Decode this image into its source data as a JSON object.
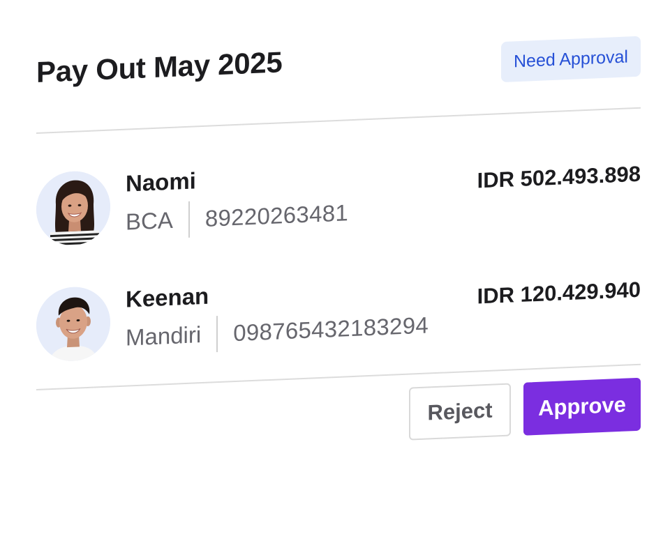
{
  "header": {
    "title": "Pay Out May 2025",
    "status_badge": "Need Approval"
  },
  "payees": [
    {
      "name": "Naomi",
      "bank": "BCA",
      "account_number": "89220263481",
      "amount": "IDR 502.493.898"
    },
    {
      "name": "Keenan",
      "bank": "Mandiri",
      "account_number": "098765432183294",
      "amount": "IDR 120.429.940"
    }
  ],
  "actions": {
    "reject_label": "Reject",
    "approve_label": "Approve"
  },
  "colors": {
    "accent": "#7b2ee0",
    "badge_bg": "#e7eefb",
    "badge_text": "#2650d6",
    "avatar_bg": "#e6ecfa"
  },
  "icons": {
    "avatar_1": "person-photo-icon",
    "avatar_2": "person-photo-icon"
  }
}
